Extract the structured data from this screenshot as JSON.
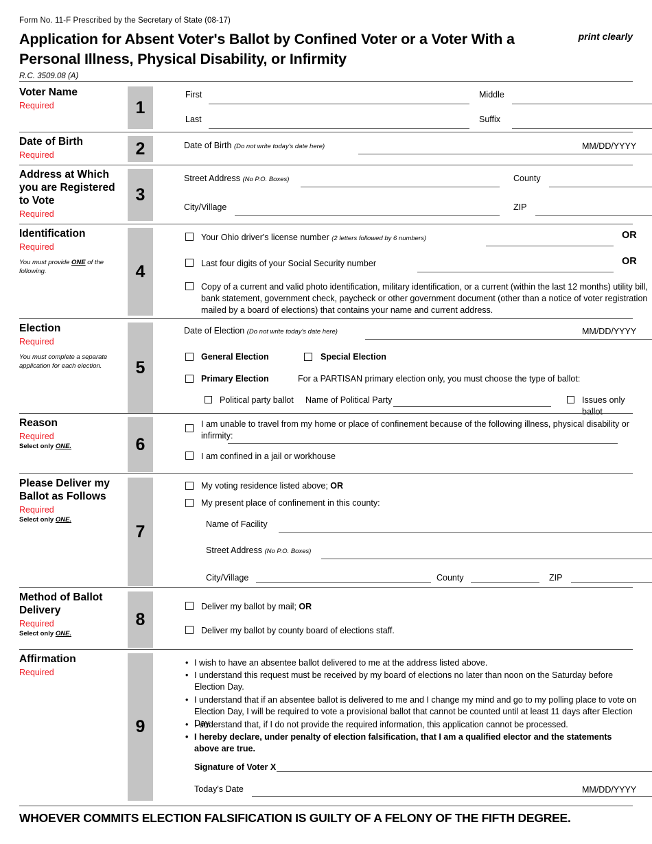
{
  "header": {
    "form_number": "Form No. 11-F Prescribed by the Secretary of State (08-17)",
    "title": "Application for Absent Voter's Ballot by Confined Voter or a Voter With a Personal Illness, Physical Disability, or Infirmity",
    "print_clearly": "print clearly",
    "revised_code": "R.C. 3509.08 (A)"
  },
  "colors": {
    "required_red": "#ee1c25",
    "number_box_gray": "#c4c4c4",
    "rule_gray": "#4d4d4d"
  },
  "labels": {
    "required": "Required",
    "select_only_one_prefix": "Select only ",
    "select_only_one_emph": "ONE.",
    "or": "OR",
    "mmddyyyy": "MM/DD/YYYY"
  },
  "sections": [
    {
      "number": "1",
      "heading": "Voter Name",
      "required": "Required",
      "fields": {
        "first": "First",
        "middle": "Middle",
        "last": "Last",
        "suffix": "Suffix"
      }
    },
    {
      "number": "2",
      "heading": "Date of Birth",
      "required": "Required",
      "fields": {
        "dob_label": "Date of Birth",
        "dob_note": "(Do not write today's date here)",
        "format": "MM/DD/YYYY"
      }
    },
    {
      "number": "3",
      "heading": "Address at Which you are Registered to Vote",
      "required": "Required",
      "fields": {
        "street": "Street Address",
        "street_note": "(No P.O.  Boxes)",
        "county": "County",
        "city": "City/Village",
        "zip": "ZIP"
      }
    },
    {
      "number": "4",
      "heading": "Identification",
      "required": "Required",
      "instruction_prefix": "You must provide ",
      "instruction_emph": "ONE",
      "instruction_suffix": " of the following.",
      "options": [
        {
          "text": "Your Ohio driver's license number",
          "note": "(2 letters followed by 6 numbers)",
          "or": "OR"
        },
        {
          "text": "Last four digits of your Social Security number",
          "note": "",
          "or": "OR"
        },
        {
          "text": "Copy of a current and valid photo identification, military identification, or a current (within the last 12 months) utility bill, bank statement, government check, paycheck or other government document (other than a notice of voter registration mailed by a board of elections) that contains your name and current address.",
          "note": "",
          "or": ""
        }
      ]
    },
    {
      "number": "5",
      "heading": "Election",
      "required": "Required",
      "instruction": "You must complete a separate application for each election.",
      "fields": {
        "date_label": "Date of Election",
        "date_note": "(Do not write today's date here)",
        "format": "MM/DD/YYYY",
        "general": "General Election",
        "special": "Special Election",
        "primary": "Primary Election",
        "partisan_note": "For a PARTISAN primary election only, you must choose the type of ballot:",
        "party_ballot": "Political party ballot",
        "party_name_label": "Name of Political Party",
        "issues_ballot": "Issues only ballot"
      }
    },
    {
      "number": "6",
      "heading": "Reason",
      "required": "Required",
      "select_one": "Select only ONE.",
      "options": [
        "I am unable to travel from my home or place of confinement because of the following illness, physical disability or infirmity:",
        "I am confined in a jail or workhouse"
      ]
    },
    {
      "number": "7",
      "heading": "Please Deliver my Ballot as Follows",
      "required": "Required",
      "select_one": "Select only ONE.",
      "options": [
        {
          "text": "My voting residence listed above; ",
          "bold_tail": "OR"
        },
        {
          "text": "My present place of confinement in this county:",
          "bold_tail": ""
        }
      ],
      "fields": {
        "facility": "Name of Facility",
        "street": "Street Address",
        "street_note": "(No P.O.  Boxes)",
        "city": "City/Village",
        "county": "County",
        "zip": "ZIP"
      }
    },
    {
      "number": "8",
      "heading": "Method of Ballot Delivery",
      "required": "Required",
      "select_one": "Select only ONE.",
      "options": [
        {
          "text": "Deliver my ballot by mail; ",
          "bold_tail": "OR"
        },
        {
          "text": "Deliver my ballot by county board of elections staff.",
          "bold_tail": ""
        }
      ]
    },
    {
      "number": "9",
      "heading": "Affirmation",
      "required": "Required",
      "bullets": [
        {
          "text": "I wish to have an absentee ballot delivered to me at the address listed above.",
          "bold": false
        },
        {
          "text": "I understand this request must be received by my board of elections no later than noon on the Saturday before Election Day.",
          "bold": false
        },
        {
          "text": "I understand that if an absentee ballot is delivered to me and I change my mind and go to my polling place to vote on Election Day, I will be required to vote a provisional ballot that cannot be counted until at least 11 days after Election Day.",
          "bold": false
        },
        {
          "text": "I understand that, if I do not provide the required information, this application cannot be processed.",
          "bold": false
        },
        {
          "text": "I hereby declare, under penalty of election falsification, that I am a qualified elector and the statements above are true.",
          "bold": true
        }
      ],
      "fields": {
        "signature": "Signature of Voter X",
        "today": "Today's Date",
        "format": "MM/DD/YYYY"
      }
    }
  ],
  "footer": {
    "warning": "WHOEVER COMMITS ELECTION FALSIFICATION IS GUILTY OF A FELONY OF THE FIFTH DEGREE."
  }
}
